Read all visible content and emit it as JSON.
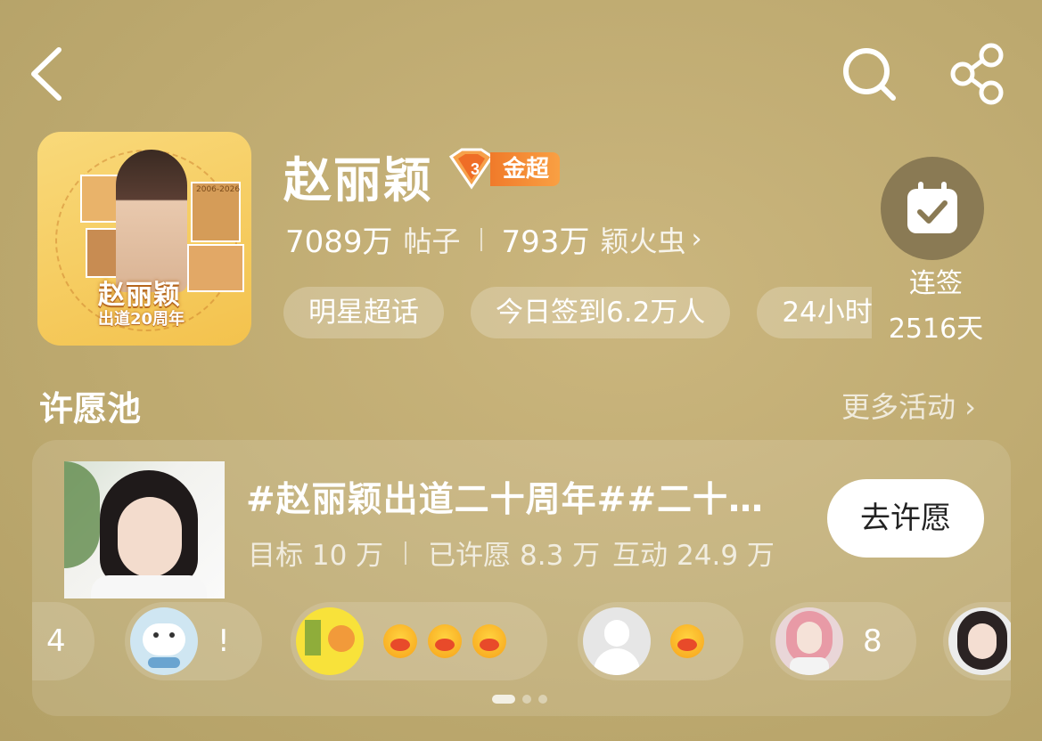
{
  "topic": {
    "name": "赵丽颖",
    "badge_level": "3",
    "badge_label": "金超",
    "avatar_name": "赵丽颖",
    "avatar_subtitle": "出道20周年",
    "avatar_years": "2006-2026",
    "posts_count": "7089万",
    "posts_unit": "帖子",
    "fans_count": "793万",
    "fans_unit": "颖火虫",
    "fans_chevron": "›"
  },
  "tags": [
    "明星超话",
    "今日签到6.2万人",
    "24小时"
  ],
  "checkin": {
    "label": "连签",
    "days": "2516天"
  },
  "wish_pool": {
    "section_title": "许愿池",
    "more_label": "更多活动 ›",
    "title": "#赵丽颖出道二十周年##二十周年快乐#",
    "target": "目标 10 万",
    "wished": "已许愿 8.3 万",
    "interactions": "互动 24.9 万",
    "button_label": "去许愿"
  },
  "comments": [
    {
      "text": "4"
    },
    {
      "text": "!"
    },
    {
      "text": ""
    },
    {
      "text": ""
    },
    {
      "text": "8"
    },
    {
      "text": ""
    }
  ],
  "icons": [
    "back-icon",
    "search-icon",
    "share-icon",
    "calendar-check-icon",
    "diamond-badge-icon"
  ],
  "colors": {
    "background": "#bfab72",
    "badge_orange": "#f38a33",
    "checkin_circle": "#8a7a54"
  },
  "pager": {
    "pages": 3,
    "active": 0
  }
}
